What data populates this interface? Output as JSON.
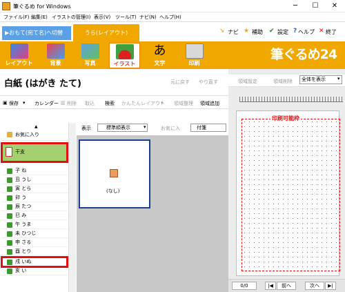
{
  "window": {
    "title": "筆ぐるめ for Windows",
    "min": "─",
    "max": "☐",
    "close": "✕"
  },
  "menu": [
    "ファイル(F)",
    "編集(E)",
    "イラストの管理(I)",
    "表示(V)",
    "ツール(T)",
    "ナビ(N)",
    "ヘルプ(H)"
  ],
  "tabs": {
    "front": "▶おもて(宛て名)へ切替",
    "back": "うら(レイアウト)"
  },
  "tools": {
    "navi": "ナビ",
    "hojo": "補助",
    "settei": "設定",
    "help": "ヘルプ",
    "end": "終了"
  },
  "ribbon": [
    "レイアウト",
    "背景",
    "写真",
    "イラスト",
    "文字",
    "印刷"
  ],
  "brand": "筆ぐるめ24",
  "document": {
    "title": "白紙  (はがき たて)",
    "undo": "元に戻す",
    "redo": "やり直す"
  },
  "toolbar": [
    "保存",
    "カレンダー",
    "削除",
    "取込",
    "検索",
    "かんたんレイアウト",
    "領域整理",
    "領域追加"
  ],
  "gallery": {
    "view_label": "表示",
    "sort_value": "標準順表示",
    "fav": "お気に入",
    "tags": "付箋",
    "thumb_label": "(なし)"
  },
  "list": {
    "favorites": "お気に入り",
    "selected": "干支",
    "items": [
      "子 ね",
      "丑 うし",
      "寅 とら",
      "卯 う",
      "辰 たつ",
      "巳 み",
      "午 うま",
      "未 ひつじ",
      "申 さる",
      "酉 とり",
      "戌 いぬ",
      "亥 い"
    ]
  },
  "right": {
    "tool1": "領域設定",
    "tool2": "領域削除",
    "zoom": "全体を表示",
    "print_area": "印刷可能枠",
    "page": "0/0",
    "prev": "前へ",
    "next": "次へ"
  }
}
